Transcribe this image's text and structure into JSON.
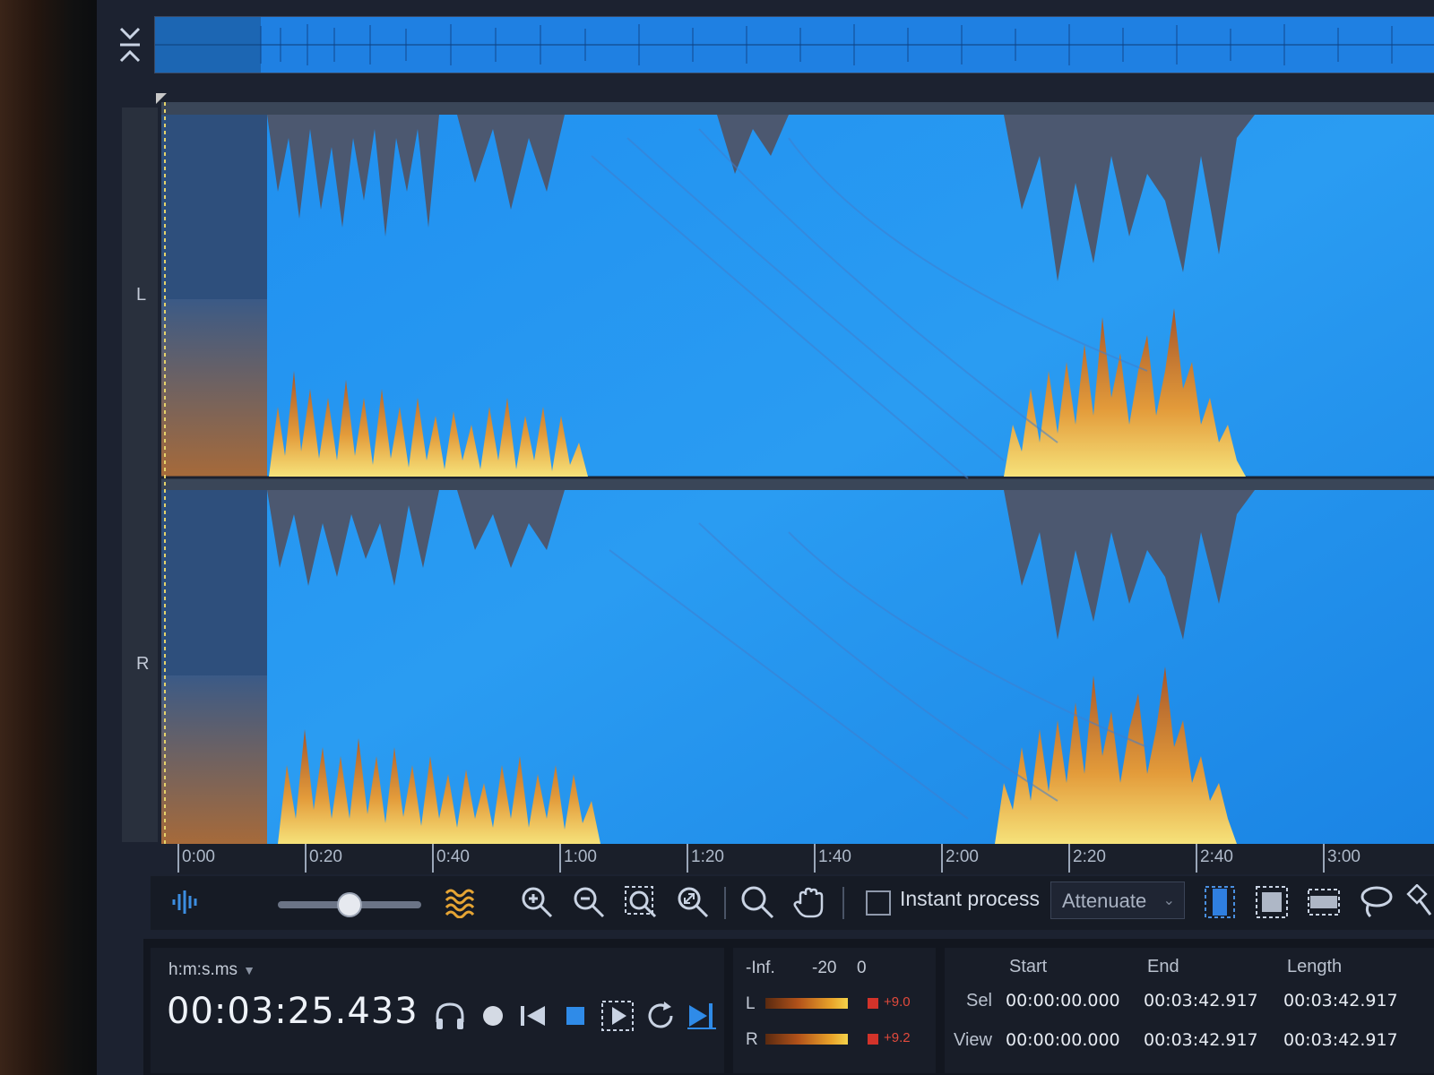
{
  "channels": {
    "left": "L",
    "right": "R"
  },
  "ruler": {
    "ticks": [
      "0:00",
      "0:20",
      "0:40",
      "1:00",
      "1:20",
      "1:40",
      "2:00",
      "2:20",
      "2:40",
      "3:00"
    ]
  },
  "toolbar": {
    "instant_process_label": "Instant process",
    "instant_process_checked": false,
    "mode_value": "Attenuate",
    "spectrogram_contrast": 0.5
  },
  "time_display": {
    "format_label": "h:m:s.ms",
    "current_time": "00:03:25.433"
  },
  "meters": {
    "scale": [
      "-Inf.",
      "-20",
      "0"
    ],
    "left_label": "L",
    "right_label": "R",
    "left_peak": "+9.0",
    "right_peak": "+9.2"
  },
  "selection": {
    "headers": {
      "start": "Start",
      "end": "End",
      "length": "Length"
    },
    "rows": [
      {
        "label": "Sel",
        "start": "00:00:00.000",
        "end": "00:03:42.917",
        "length": "00:03:42.917"
      },
      {
        "label": "View",
        "start": "00:00:00.000",
        "end": "00:03:42.917",
        "length": "00:03:42.917"
      }
    ]
  }
}
